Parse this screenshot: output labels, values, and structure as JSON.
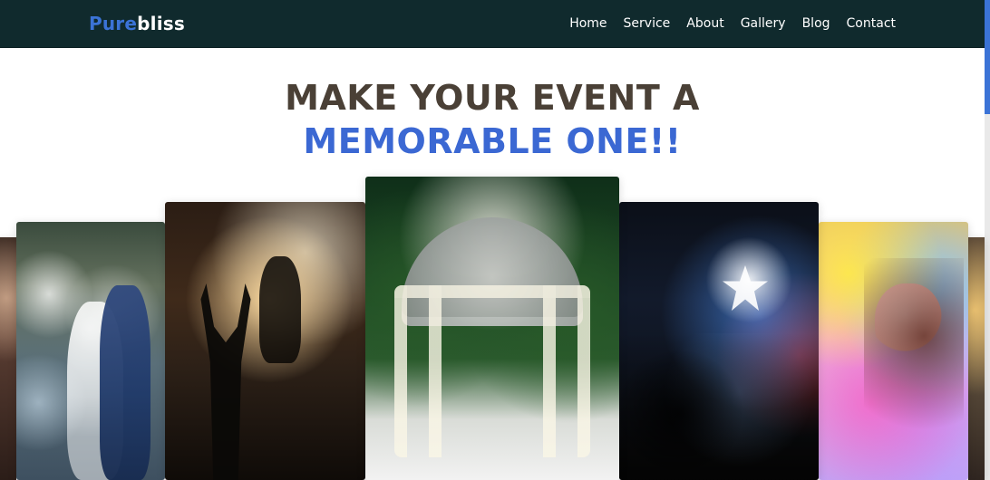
{
  "brand": {
    "part1": "Pure",
    "part2": "bliss"
  },
  "nav": {
    "items": [
      "Home",
      "Service",
      "About",
      "Gallery",
      "Blog",
      "Contact"
    ]
  },
  "hero": {
    "line1": "MAKE YOUR EVENT A",
    "line2": "MEMORABLE ONE!!"
  },
  "gallery": {
    "images": [
      {
        "name": "left-edge-photo"
      },
      {
        "name": "wedding-photo"
      },
      {
        "name": "concert-photo"
      },
      {
        "name": "gazebo-photo"
      },
      {
        "name": "club-dj-photo"
      },
      {
        "name": "holi-color-photo"
      },
      {
        "name": "right-edge-photo"
      }
    ]
  },
  "colors": {
    "navbar_bg": "#102a2d",
    "brand_accent": "#3b73d6",
    "hero_dark": "#4a4036",
    "hero_blue": "#3b68d3",
    "scrollbar_thumb": "#3b73d6"
  }
}
